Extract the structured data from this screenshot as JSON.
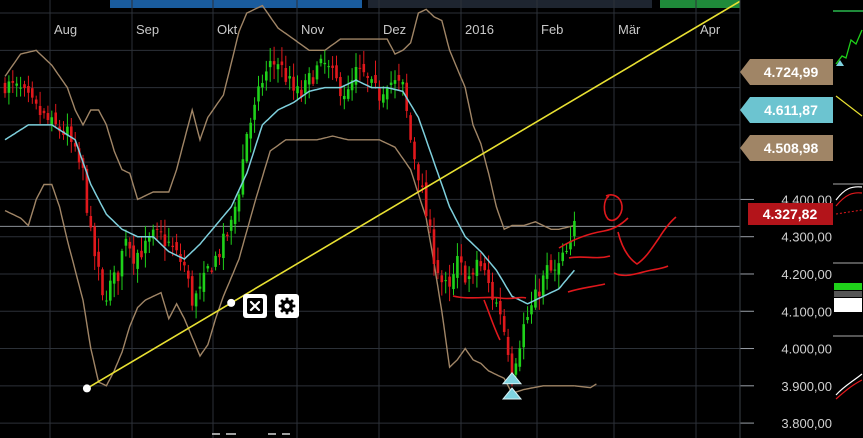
{
  "colors": {
    "background": "#000000",
    "grid": "#2c3138",
    "candle_up": "#1fd11a",
    "candle_down": "#e0181c",
    "bollinger": "#a08566",
    "moving_average": "#7ecfdc",
    "trendline": "#e8e032",
    "annotation": "#e0181c",
    "tag_bollinger": "#a08566",
    "tag_ma": "#6cc4d0",
    "tag_price": "#b3141a",
    "top_blue": "#1a5c9e",
    "top_green": "#1f8a3a"
  },
  "chart_data": {
    "type": "candlestick",
    "x_tick_labels": [
      "Aug",
      "Sep",
      "Okt",
      "Nov",
      "Dez",
      "2016",
      "Feb",
      "Mär",
      "Apr"
    ],
    "y_tick_labels": [
      "4.400,00",
      "4.300,00",
      "4.200,00",
      "4.100,00",
      "4.000,00",
      "3.900,00",
      "3.800,00"
    ],
    "y_ticks": [
      4400,
      4300,
      4200,
      4100,
      4000,
      3900,
      3800
    ],
    "ylim": [
      3760,
      4935
    ],
    "grid": true,
    "price_tags": [
      {
        "label": "4.724,99",
        "value": 4724.99,
        "series": "bollinger_upper"
      },
      {
        "label": "4.611,87",
        "value": 4611.87,
        "series": "moving_average"
      },
      {
        "label": "4.508,98",
        "value": 4508.98,
        "series": "bollinger_lower"
      },
      {
        "label": "4.327,82",
        "value": 4327.82,
        "series": "last_price"
      }
    ],
    "last_price": 4327.82,
    "close_anchors": [
      [
        0,
        4710
      ],
      [
        4,
        4690
      ],
      [
        8,
        4640
      ],
      [
        12,
        4600
      ],
      [
        16,
        4575
      ],
      [
        18,
        4520
      ],
      [
        20,
        4470
      ],
      [
        22,
        4300
      ],
      [
        24,
        4200
      ],
      [
        25,
        4130
      ],
      [
        27,
        4170
      ],
      [
        29,
        4200
      ],
      [
        31,
        4310
      ],
      [
        33,
        4250
      ],
      [
        36,
        4270
      ],
      [
        38,
        4300
      ],
      [
        40,
        4300
      ],
      [
        42,
        4280
      ],
      [
        44,
        4250
      ],
      [
        46,
        4220
      ],
      [
        48,
        4130
      ],
      [
        50,
        4150
      ],
      [
        52,
        4210
      ],
      [
        55,
        4260
      ],
      [
        58,
        4330
      ],
      [
        60,
        4430
      ],
      [
        62,
        4580
      ],
      [
        64,
        4640
      ],
      [
        66,
        4720
      ],
      [
        68,
        4760
      ],
      [
        70,
        4770
      ],
      [
        72,
        4730
      ],
      [
        74,
        4690
      ],
      [
        76,
        4680
      ],
      [
        78,
        4720
      ],
      [
        80,
        4750
      ],
      [
        82,
        4760
      ],
      [
        84,
        4730
      ],
      [
        86,
        4700
      ],
      [
        88,
        4680
      ],
      [
        90,
        4740
      ],
      [
        92,
        4730
      ],
      [
        94,
        4700
      ],
      [
        96,
        4680
      ],
      [
        98,
        4720
      ],
      [
        100,
        4710
      ],
      [
        102,
        4700
      ],
      [
        104,
        4560
      ],
      [
        106,
        4470
      ],
      [
        108,
        4360
      ],
      [
        110,
        4250
      ],
      [
        112,
        4180
      ],
      [
        114,
        4150
      ],
      [
        116,
        4230
      ],
      [
        118,
        4200
      ],
      [
        120,
        4180
      ],
      [
        121,
        4240
      ],
      [
        123,
        4200
      ],
      [
        125,
        4140
      ],
      [
        127,
        4100
      ],
      [
        129,
        4000
      ],
      [
        130,
        3940
      ],
      [
        131,
        3980
      ],
      [
        133,
        4060
      ],
      [
        135,
        4110
      ],
      [
        137,
        4160
      ],
      [
        139,
        4210
      ],
      [
        141,
        4200
      ],
      [
        143,
        4240
      ],
      [
        145,
        4270
      ],
      [
        146,
        4330
      ]
    ],
    "ma_anchors": [
      [
        0,
        4560
      ],
      [
        6,
        4600
      ],
      [
        12,
        4600
      ],
      [
        18,
        4560
      ],
      [
        22,
        4440
      ],
      [
        26,
        4360
      ],
      [
        30,
        4320
      ],
      [
        34,
        4300
      ],
      [
        38,
        4300
      ],
      [
        42,
        4260
      ],
      [
        46,
        4240
      ],
      [
        50,
        4280
      ],
      [
        54,
        4330
      ],
      [
        58,
        4380
      ],
      [
        62,
        4470
      ],
      [
        66,
        4600
      ],
      [
        70,
        4640
      ],
      [
        74,
        4660
      ],
      [
        78,
        4690
      ],
      [
        82,
        4700
      ],
      [
        86,
        4700
      ],
      [
        90,
        4720
      ],
      [
        94,
        4700
      ],
      [
        98,
        4700
      ],
      [
        102,
        4690
      ],
      [
        106,
        4620
      ],
      [
        110,
        4500
      ],
      [
        114,
        4380
      ],
      [
        118,
        4300
      ],
      [
        122,
        4260
      ],
      [
        126,
        4210
      ],
      [
        130,
        4140
      ],
      [
        134,
        4120
      ],
      [
        138,
        4140
      ],
      [
        142,
        4160
      ],
      [
        146,
        4210
      ]
    ],
    "boll_up_anchors": [
      [
        0,
        4730
      ],
      [
        4,
        4790
      ],
      [
        8,
        4800
      ],
      [
        12,
        4760
      ],
      [
        16,
        4700
      ],
      [
        18,
        4640
      ],
      [
        20,
        4600
      ],
      [
        22,
        4640
      ],
      [
        24,
        4640
      ],
      [
        26,
        4600
      ],
      [
        28,
        4530
      ],
      [
        30,
        4480
      ],
      [
        32,
        4470
      ],
      [
        34,
        4400
      ],
      [
        38,
        4420
      ],
      [
        42,
        4420
      ],
      [
        44,
        4480
      ],
      [
        46,
        4560
      ],
      [
        48,
        4640
      ],
      [
        50,
        4560
      ],
      [
        52,
        4620
      ],
      [
        56,
        4680
      ],
      [
        60,
        4850
      ],
      [
        62,
        4900
      ],
      [
        66,
        4920
      ],
      [
        70,
        4860
      ],
      [
        74,
        4830
      ],
      [
        78,
        4800
      ],
      [
        82,
        4800
      ],
      [
        86,
        4830
      ],
      [
        90,
        4830
      ],
      [
        94,
        4830
      ],
      [
        98,
        4830
      ],
      [
        100,
        4790
      ],
      [
        102,
        4800
      ],
      [
        104,
        4820
      ],
      [
        106,
        4900
      ],
      [
        108,
        4910
      ],
      [
        110,
        4890
      ],
      [
        112,
        4880
      ],
      [
        114,
        4800
      ],
      [
        118,
        4700
      ],
      [
        120,
        4600
      ],
      [
        122,
        4550
      ],
      [
        124,
        4470
      ],
      [
        126,
        4380
      ],
      [
        128,
        4320
      ],
      [
        130,
        4330
      ],
      [
        133,
        4330
      ],
      [
        136,
        4340
      ],
      [
        140,
        4320
      ],
      [
        142,
        4320
      ],
      [
        146,
        4330
      ]
    ],
    "boll_dn_anchors": [
      [
        0,
        4370
      ],
      [
        2,
        4360
      ],
      [
        4,
        4350
      ],
      [
        6,
        4330
      ],
      [
        8,
        4400
      ],
      [
        10,
        4440
      ],
      [
        12,
        4440
      ],
      [
        14,
        4380
      ],
      [
        16,
        4290
      ],
      [
        18,
        4210
      ],
      [
        20,
        4130
      ],
      [
        22,
        4000
      ],
      [
        24,
        3910
      ],
      [
        26,
        3900
      ],
      [
        28,
        3940
      ],
      [
        30,
        3990
      ],
      [
        32,
        4060
      ],
      [
        34,
        4110
      ],
      [
        36,
        4130
      ],
      [
        38,
        4140
      ],
      [
        40,
        4150
      ],
      [
        42,
        4080
      ],
      [
        44,
        4120
      ],
      [
        46,
        4080
      ],
      [
        48,
        4030
      ],
      [
        50,
        3980
      ],
      [
        52,
        4010
      ],
      [
        54,
        4080
      ],
      [
        56,
        4140
      ],
      [
        60,
        4240
      ],
      [
        64,
        4390
      ],
      [
        68,
        4530
      ],
      [
        72,
        4560
      ],
      [
        76,
        4560
      ],
      [
        80,
        4560
      ],
      [
        84,
        4570
      ],
      [
        88,
        4560
      ],
      [
        92,
        4560
      ],
      [
        96,
        4560
      ],
      [
        100,
        4540
      ],
      [
        104,
        4480
      ],
      [
        108,
        4350
      ],
      [
        110,
        4230
      ],
      [
        112,
        4100
      ],
      [
        114,
        3950
      ],
      [
        116,
        3970
      ],
      [
        118,
        4000
      ],
      [
        120,
        3970
      ],
      [
        122,
        3960
      ],
      [
        124,
        3940
      ],
      [
        126,
        3930
      ],
      [
        128,
        3920
      ],
      [
        130,
        3880
      ],
      [
        133,
        3890
      ],
      [
        138,
        3900
      ],
      [
        142,
        3900
      ],
      [
        146,
        3900
      ]
    ],
    "trendline": {
      "from": {
        "bar": 21,
        "value": 3893
      },
      "to": {
        "bar": 189,
        "value": 4935
      }
    },
    "markers": [
      {
        "type": "triangle-up",
        "bar": 130,
        "value": 3919
      },
      {
        "type": "triangle-up",
        "bar": 130,
        "value": 3878
      }
    ],
    "icons": [
      "close-icon",
      "gear-icon"
    ]
  }
}
